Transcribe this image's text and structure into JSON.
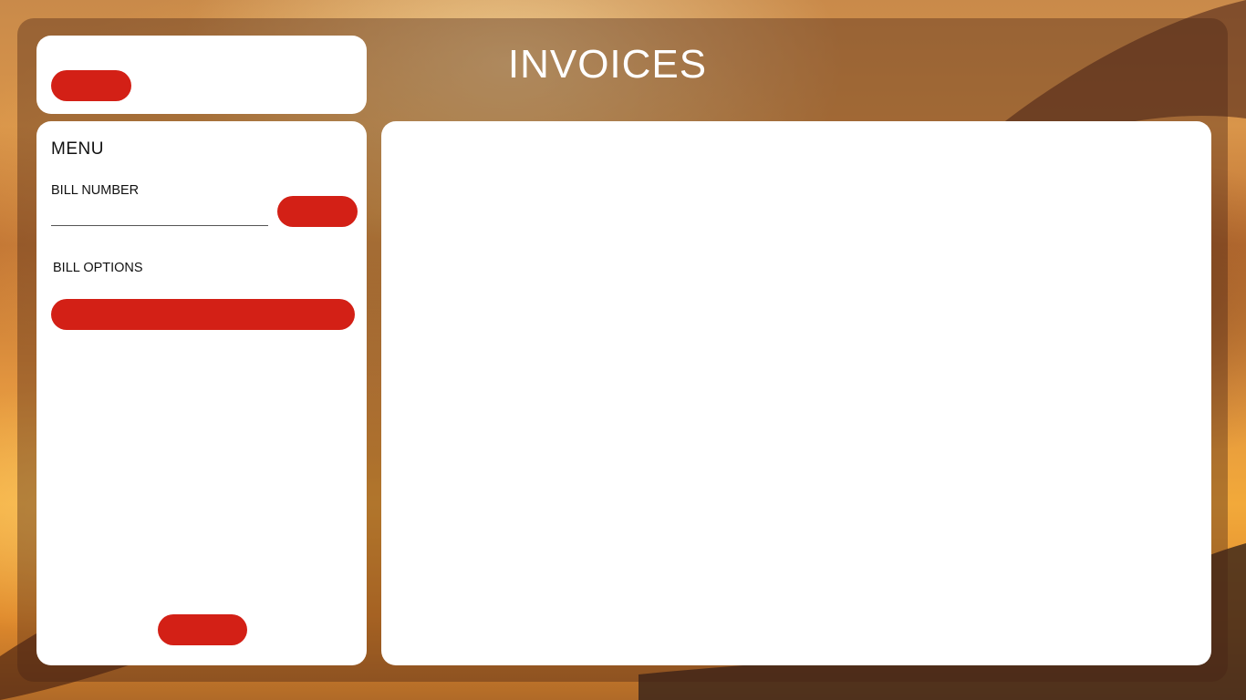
{
  "header": {
    "title": "INVOICES"
  },
  "top_card": {
    "button_label": ""
  },
  "menu": {
    "title": "MENU",
    "bill_number_label": "BILL NUMBER",
    "bill_number_value": "",
    "bill_number_placeholder": "",
    "search_button_label": "",
    "bill_options_label": "BILL OPTIONS",
    "bill_option_button_label": "",
    "bottom_button_label": ""
  },
  "content": {},
  "colors": {
    "accent": "#d32016",
    "panel": "#ffffff",
    "title": "#ffffff"
  }
}
